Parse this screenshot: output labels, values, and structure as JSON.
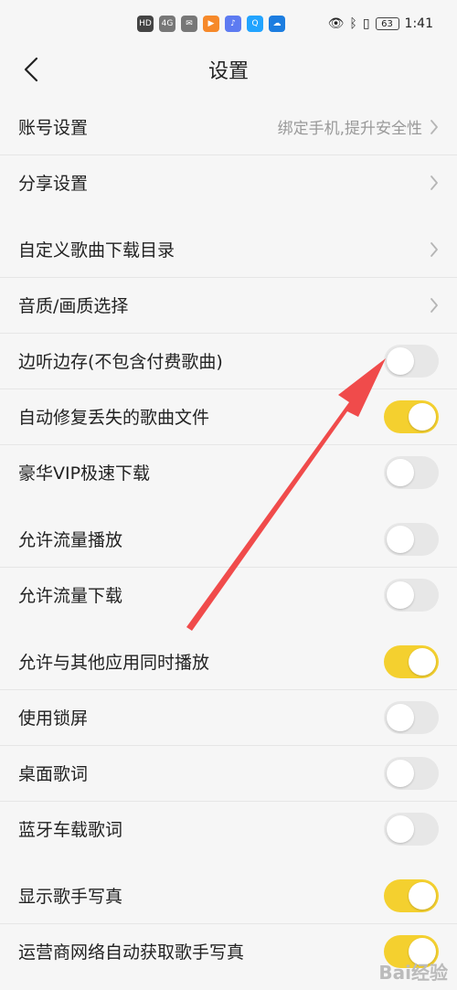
{
  "status_bar": {
    "hd": "HD",
    "net": "4G",
    "battery": "63",
    "time": "1:41"
  },
  "header": {
    "title": "设置"
  },
  "sections": [
    {
      "rows": [
        {
          "label": "账号设置",
          "hint": "绑定手机,提升安全性",
          "type": "nav"
        },
        {
          "label": "分享设置",
          "type": "nav"
        }
      ]
    },
    {
      "rows": [
        {
          "label": "自定义歌曲下载目录",
          "type": "nav"
        },
        {
          "label": "音质/画质选择",
          "type": "nav"
        },
        {
          "label": "边听边存(不包含付费歌曲)",
          "type": "toggle",
          "on": false
        },
        {
          "label": "自动修复丢失的歌曲文件",
          "type": "toggle",
          "on": true
        },
        {
          "label": "豪华VIP极速下载",
          "type": "toggle",
          "on": false
        }
      ]
    },
    {
      "rows": [
        {
          "label": "允许流量播放",
          "type": "toggle",
          "on": false
        },
        {
          "label": "允许流量下载",
          "type": "toggle",
          "on": false
        }
      ]
    },
    {
      "rows": [
        {
          "label": "允许与其他应用同时播放",
          "type": "toggle",
          "on": true
        },
        {
          "label": "使用锁屏",
          "type": "toggle",
          "on": false
        },
        {
          "label": "桌面歌词",
          "type": "toggle",
          "on": false
        },
        {
          "label": "蓝牙车载歌词",
          "type": "toggle",
          "on": false
        }
      ]
    },
    {
      "rows": [
        {
          "label": "显示歌手写真",
          "type": "toggle",
          "on": true
        },
        {
          "label": "运营商网络自动获取歌手写真",
          "type": "toggle",
          "on": true
        }
      ]
    }
  ],
  "colors": {
    "toggle_on": "#f4d02f",
    "toggle_off": "#e7e7e7",
    "arrow": "#f04b4b"
  },
  "watermark": "Bai经验"
}
